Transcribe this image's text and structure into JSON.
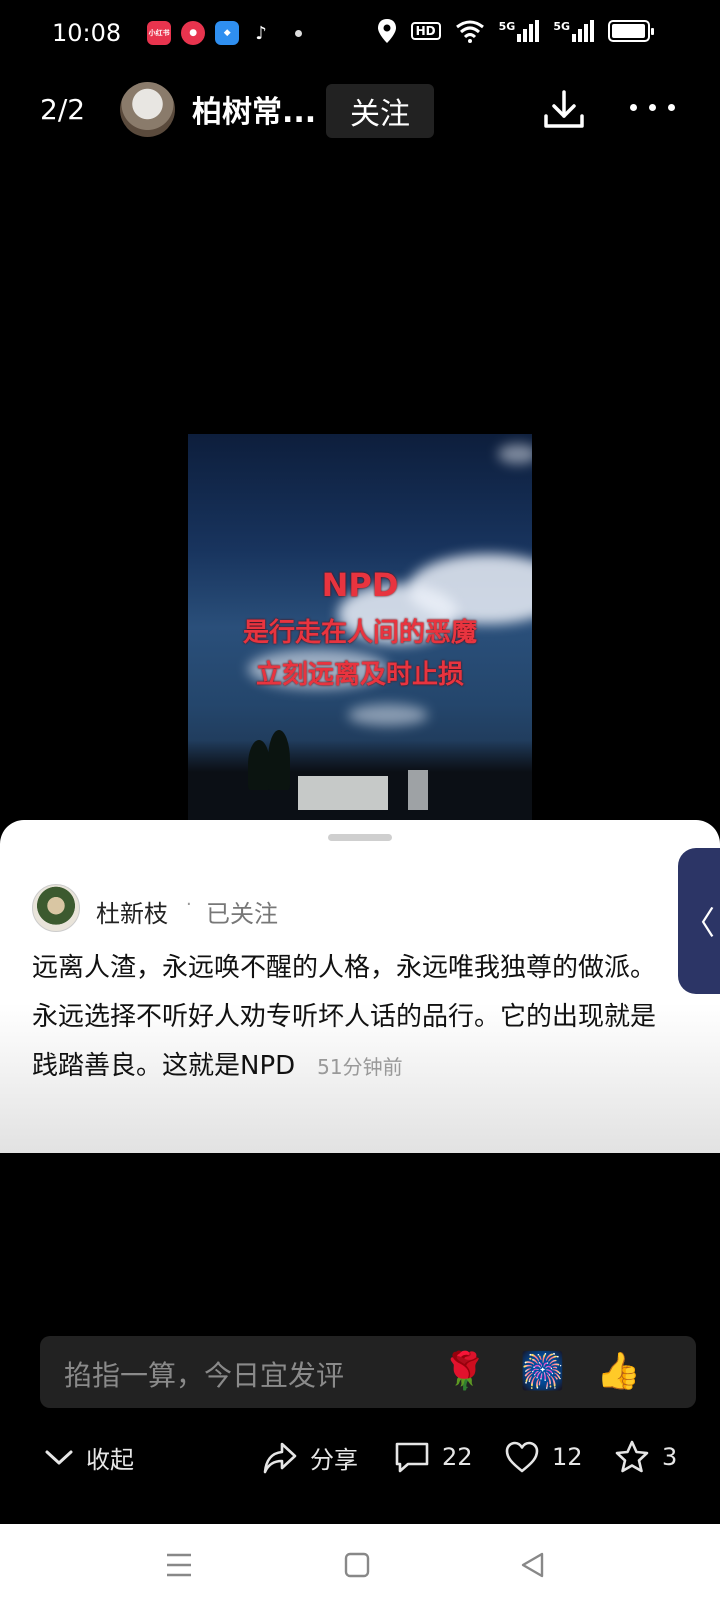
{
  "status_bar": {
    "time": "10:08",
    "app_badges": [
      "小红书",
      "",
      "",
      "♪"
    ],
    "hd_label": "HD",
    "network_label_1": "5G",
    "network_label_2": "5G"
  },
  "header": {
    "page_counter": "2/2",
    "author_name": "柏树常...",
    "follow_label": "关注"
  },
  "media": {
    "line1": "NPD",
    "line2": "是行走在人间的恶魔",
    "line3": "立刻远离及时止损"
  },
  "comment": {
    "author": "杜新枝",
    "separator": "·",
    "follow_status": "已关注",
    "text": "远离人渣，永远唤不醒的人格，永远唯我独尊的做派。永远选择不听好人劝专听坏人话的品行。它的出现就是践踏善良。这就是NPD",
    "time": "51分钟前",
    "side_tab_glyph": "〈"
  },
  "input": {
    "placeholder": "掐指一算，今日宜发评",
    "emojis": [
      "🌹",
      "🎆",
      "👍"
    ]
  },
  "actions": {
    "collapse_label": "收起",
    "share_label": "分享",
    "comment_count": "22",
    "like_count": "12",
    "favorite_count": "3"
  }
}
